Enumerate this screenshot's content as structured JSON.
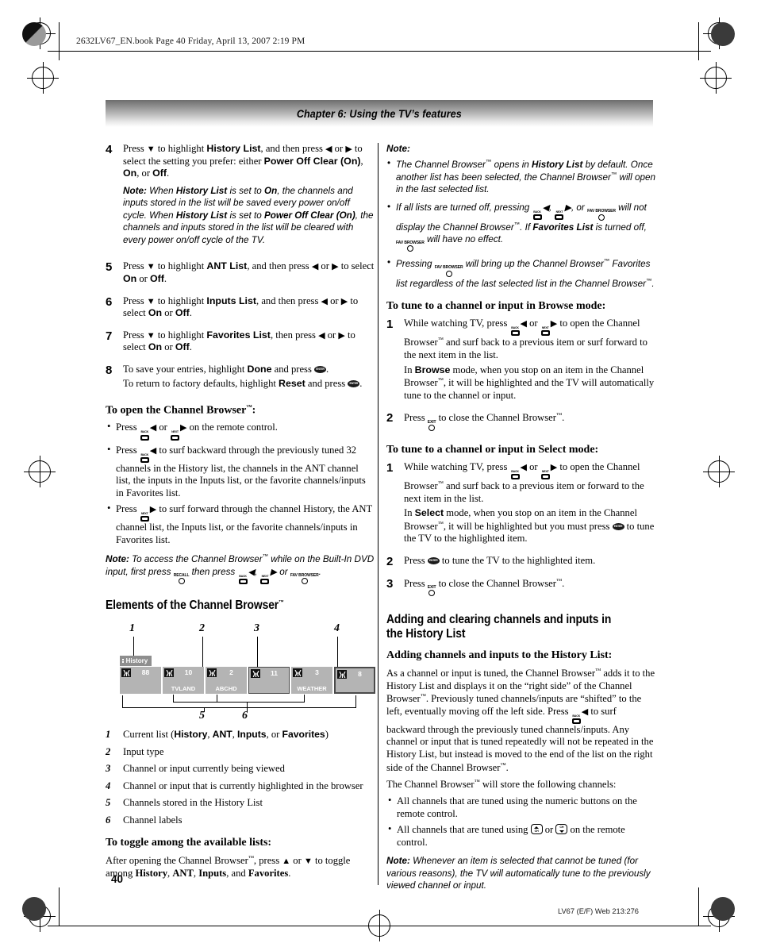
{
  "header": {
    "book_line": "2632LV67_EN.book  Page 40  Friday, April 13, 2007  2:19 PM",
    "chapter_title": "Chapter 6: Using the TV’s features"
  },
  "footer": {
    "page_number": "40",
    "code": "LV67 (E/F) Web 213:276"
  },
  "icons": {
    "back": "BACK",
    "next": "NEXT",
    "recall": "RECALL",
    "exit": "EXIT",
    "fav_browser": "FAV BROWSER",
    "enter": "ENTER",
    "ch_up": "CH",
    "ch_down": "CH",
    "left_arrow": "◀",
    "right_arrow": "▶",
    "up_arrow": "▲",
    "down_arrow": "▼"
  },
  "left_column": {
    "steps": [
      {
        "num": "4",
        "lines": [
          "Press ▼ to highlight <b class='bold-sans'>History List</b>, and then press ◀ or ▶ to select the setting you prefer: either <b class='bold-sans'>Power Off Clear (On)</b>, <b class='bold-sans'>On</b>, or <b class='bold-sans'>Off</b>."
        ],
        "note": "<span class='lbl'>Note:</span> When <b>History List</b> is set to <b>On</b>, the channels and inputs stored in the list will be saved every power on/off cycle. When <b>History List</b> is set to <b>Power Off Clear (On)</b>, the channels and inputs stored in the list will be cleared with every power on/off cycle of the TV."
      },
      {
        "num": "5",
        "lines": [
          "Press ▼ to highlight <b class='bold-sans'>ANT List</b>, and then press ◀ or ▶ to select <b class='bold-sans'>On</b> or <b class='bold-sans'>Off</b>."
        ]
      },
      {
        "num": "6",
        "lines": [
          "Press ▼ to highlight <b class='bold-sans'>Inputs List</b>, and then press ◀ or ▶ to select <b class='bold-sans'>On</b> or <b class='bold-sans'>Off</b>."
        ]
      },
      {
        "num": "7",
        "lines": [
          "Press ▼ to highlight <b class='bold-sans'>Favorites List</b>, then press ◀ or ▶ to select <b class='bold-sans'>On</b> or <b class='bold-sans'>Off</b>."
        ]
      },
      {
        "num": "8",
        "lines": [
          "To save your entries, highlight <b class='bold-sans'>Done</b> and press [ENTER].",
          "To return to factory defaults, highlight <b class='bold-sans'>Reset</b> and press [ENTER]."
        ]
      }
    ],
    "open_browser": {
      "heading": "To open the Channel Browser™:",
      "bullets": [
        "Press [BACK]◀ or [NEXT]▶ on the remote control.",
        "Press [BACK]◀ to surf backward through the previously tuned 32 channels in the History list, the channels in the ANT channel list, the inputs in the Inputs list, or the favorite channels/inputs in Favorites list.",
        "Press [NEXT]▶ to surf forward through the channel History, the ANT channel list, the Inputs list, or the favorite channels/inputs in Favorites list."
      ],
      "note": "<span class='lbl'>Note:</span> To access the Channel Browser™ while on the Built-In DVD input, first press [RECALL] then press [BACK]◀, [NEXT]▶ or [FAV BROWSER]."
    },
    "elements_section": {
      "heading": "Elements of the Channel Browser™",
      "callouts": [
        "1",
        "2",
        "3",
        "4",
        "5",
        "6"
      ],
      "browser": {
        "list_name": "History",
        "cells": [
          {
            "channel": "88",
            "label": "",
            "state": "plain"
          },
          {
            "channel": "10",
            "label": "TVLAND",
            "state": "plain"
          },
          {
            "channel": "2",
            "label": "ABCHD",
            "state": "plain"
          },
          {
            "channel": "11",
            "label": "",
            "state": "viewing"
          },
          {
            "channel": "3",
            "label": "WEATHER",
            "state": "plain"
          },
          {
            "channel": "8",
            "label": "",
            "state": "highlighted"
          }
        ]
      },
      "legend": [
        {
          "num": "1",
          "text": "Current list (<b>History</b>, <b>ANT</b>, <b>Inputs</b>, or <b>Favorites</b>)"
        },
        {
          "num": "2",
          "text": "Input type"
        },
        {
          "num": "3",
          "text": "Channel or input currently being viewed"
        },
        {
          "num": "4",
          "text": "Channel or input that is currently highlighted in the browser"
        },
        {
          "num": "5",
          "text": "Channels stored in the History List"
        },
        {
          "num": "6",
          "text": "Channel labels"
        }
      ]
    },
    "toggle_section": {
      "heading": "To toggle among the available lists:",
      "text": "After opening the Channel Browser™, press ▲ or ▼ to toggle among <b class='bold-sans'>History</b>, <b class='bold-sans'>ANT</b>, <b class='bold-sans'>Inputs</b>, and <b class='bold-sans'>Favorites</b>."
    }
  },
  "right_column": {
    "note_block": {
      "label": "Note:",
      "items": [
        "The Channel Browser™ opens in <b>History List</b> by default. Once another list has been selected, the Channel Browser™ will open in the last selected list.",
        "If all lists are turned off, pressing [BACK]◀, [NEXT]▶, or [FAV BROWSER] will not display the Channel Browser™. If <b>Favorites List</b> is turned off, [FAV BROWSER] will have no effect.",
        "Pressing [FAV BROWSER] will bring up the Channel Browser™ Favorites list regardless of the last selected list in the Channel Browser™."
      ]
    },
    "browse_mode": {
      "heading": "To tune to a channel or input in Browse mode:",
      "steps": [
        {
          "num": "1",
          "lines": [
            "While watching TV, press [BACK]◀ or [NEXT]▶ to open the Channel Browser™ and surf back to a previous item or surf forward to the next item in the list.",
            "In <b class='bold-sans'>Browse</b> mode, when you stop on an item in the Channel Browser™, it will be highlighted and the TV will automatically tune to the channel or input."
          ]
        },
        {
          "num": "2",
          "lines": [
            "Press [EXIT] to close the Channel Browser™."
          ]
        }
      ]
    },
    "select_mode": {
      "heading": "To tune to a channel or input in Select mode:",
      "steps": [
        {
          "num": "1",
          "lines": [
            "While watching TV, press [BACK]◀ or [NEXT]▶ to open the Channel Browser™ and surf back to a previous item or forward to the next item in the list.",
            "In <b class='bold-sans'>Select</b> mode, when you stop on an item in the Channel Browser™, it will be highlighted but you must press [ENTER] to tune the TV to the highlighted item."
          ]
        },
        {
          "num": "2",
          "lines": [
            "Press [ENTER] to tune the TV to the highlighted item."
          ]
        },
        {
          "num": "3",
          "lines": [
            "Press [EXIT] to close the Channel Browser™."
          ]
        }
      ]
    },
    "history_section": {
      "heading": "Adding and clearing channels and inputs in the History List",
      "sub_heading": "Adding channels and inputs to the History List:",
      "paragraph1": "As a channel or input is tuned, the Channel Browser™ adds it to the History List and displays it on the “right side” of the Channel Browser™. Previously tuned channels/inputs are “shifted” to the left, eventually moving off the left side. Press [BACK]◀ to surf backward through the previously tuned channels/inputs. Any channel or input that is tuned repeatedly will not be repeated in the History List, but instead is moved to the end of the list on the right side of the Channel Browser™.",
      "paragraph2": "The Channel Browser™ will store the following channels:",
      "bullets": [
        "All channels that are tuned using the numeric buttons on the remote control.",
        "All channels that are tuned using [CH-UP] or [CH-DOWN] on the remote control."
      ],
      "note": "<span class='lbl'>Note:</span> Whenever an item is selected that cannot be tuned (for various reasons), the TV will automatically tune to the previously viewed channel or input."
    }
  }
}
